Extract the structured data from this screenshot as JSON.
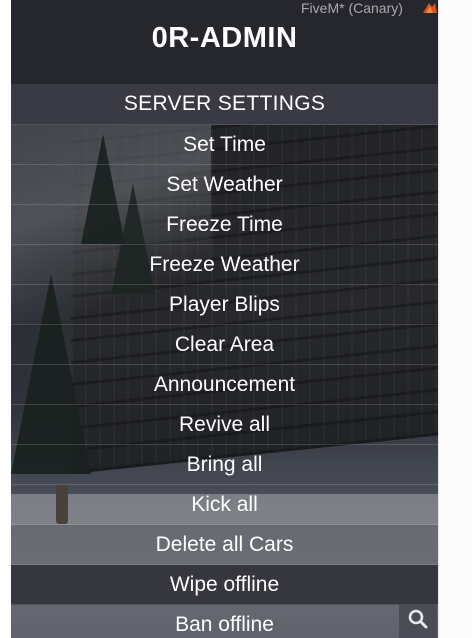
{
  "window": {
    "client_label": "FiveM* (Canary)",
    "client_icon": "fivem-logo-icon"
  },
  "header": {
    "title": "0R-ADMIN"
  },
  "menu": {
    "section_title": "SERVER SETTINGS",
    "items": [
      {
        "label": "Set Time"
      },
      {
        "label": "Set Weather"
      },
      {
        "label": "Freeze Time"
      },
      {
        "label": "Freeze Weather"
      },
      {
        "label": "Player Blips"
      },
      {
        "label": "Clear Area"
      },
      {
        "label": "Announcement"
      },
      {
        "label": "Revive all"
      },
      {
        "label": "Bring all"
      },
      {
        "label": "Kick all"
      },
      {
        "label": "Delete all Cars"
      },
      {
        "label": "Wipe offline"
      },
      {
        "label": "Ban offline"
      }
    ]
  },
  "toolbar": {
    "search_icon": "search-icon"
  },
  "colors": {
    "header_bg": "#26262d",
    "section_bg": "#3a3a44",
    "text": "#ffffff"
  }
}
